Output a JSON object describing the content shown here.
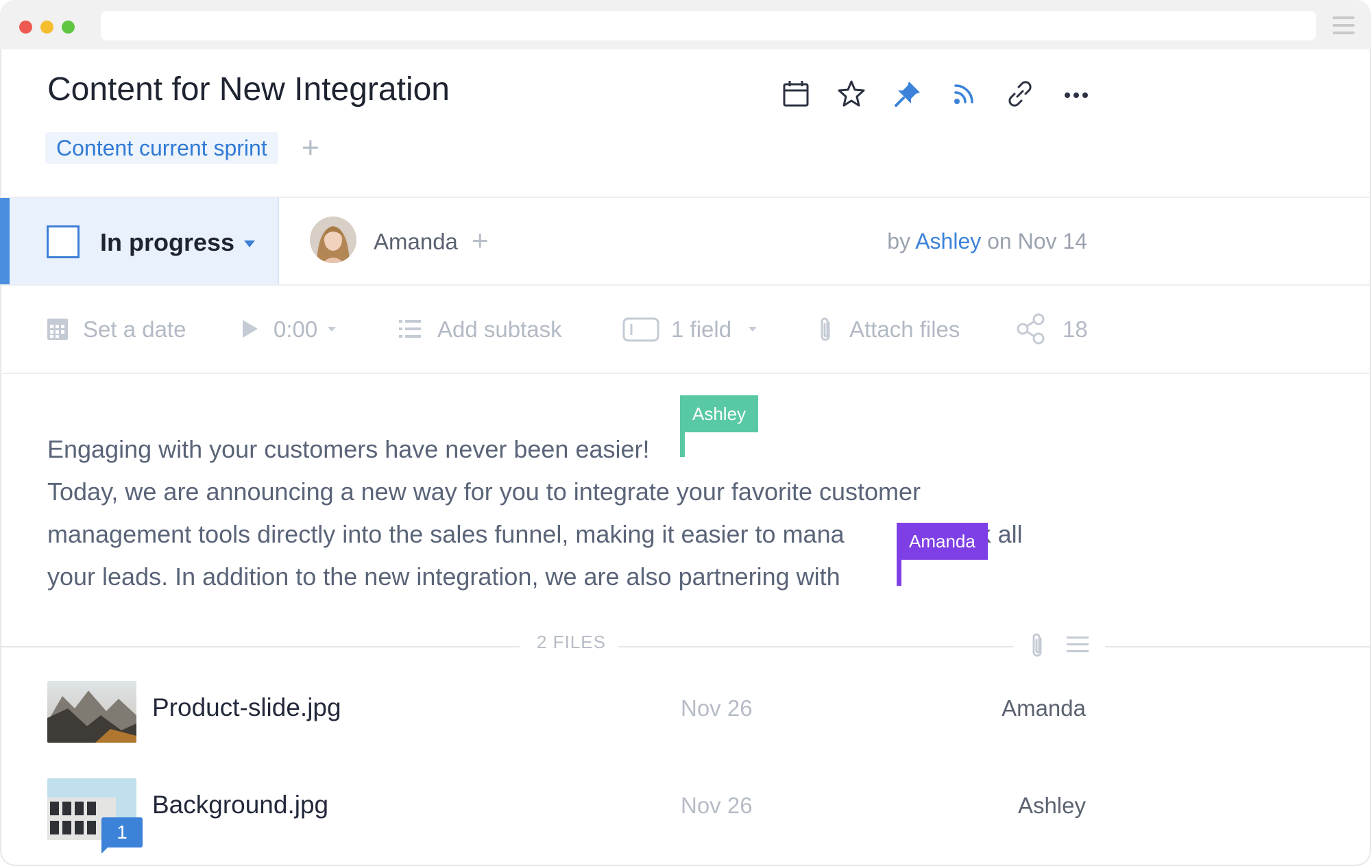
{
  "window": {
    "traffic_lights": [
      "#ee5a52",
      "#f5be2f",
      "#5ec640"
    ]
  },
  "header": {
    "title": "Content for New Integration",
    "tag": "Content current sprint",
    "icons": [
      "calendar-icon",
      "star-icon",
      "pin-icon",
      "rss-icon",
      "link-icon",
      "more-icon"
    ]
  },
  "status": {
    "label": "In progress",
    "assignee": "Amanda",
    "byline": {
      "prefix": "by",
      "author": "Ashley",
      "suffix": "on Nov 14"
    }
  },
  "actions": {
    "date": "Set a date",
    "timer": "0:00",
    "subtask": "Add subtask",
    "field": "1 field",
    "attach": "Attach files",
    "share_count": "18"
  },
  "content": {
    "lines": [
      "Engaging with your customers have never been easier!",
      "Today, we are announcing a new way for you to integrate your favorite customer",
      "management tools directly into the sales funnel, making it easier to mana",
      "rack all",
      "your leads. In addition to the new integration, we are also partnering with"
    ],
    "cursors": [
      {
        "name": "Ashley",
        "color": "#59c8a4"
      },
      {
        "name": "Amanda",
        "color": "#7e3fe6"
      }
    ]
  },
  "files": {
    "count_label": "2 FILES",
    "items": [
      {
        "name": "Product-slide.jpg",
        "date": "Nov 26",
        "owner": "Amanda"
      },
      {
        "name": "Background.jpg",
        "date": "Nov 26",
        "owner": "Ashley",
        "comments": "1"
      }
    ]
  },
  "colors": {
    "accent": "#3b82d8",
    "status_bg": "#e9f2fc"
  }
}
